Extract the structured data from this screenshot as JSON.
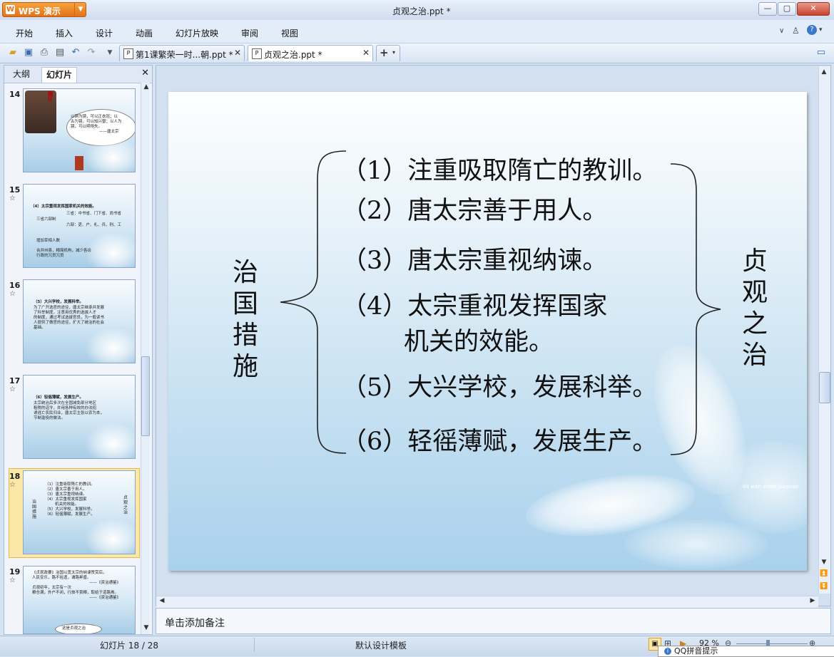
{
  "app": {
    "name": "WPS 演示",
    "document_title": "贞观之治.ppt *",
    "window_buttons": [
      "—",
      "▢",
      "✕"
    ]
  },
  "menu": {
    "items": [
      "开始",
      "插入",
      "设计",
      "动画",
      "幻灯片放映",
      "审阅",
      "视图"
    ]
  },
  "tabs": [
    {
      "label": "第1课繁荣一时...朝.ppt *",
      "active": false
    },
    {
      "label": "贞观之治.ppt *",
      "active": true
    }
  ],
  "tab_add": "+",
  "panel": {
    "tabs": [
      "大纲",
      "幻灯片"
    ],
    "active_tab": "幻灯片",
    "close": "✕"
  },
  "thumbnails": [
    {
      "number": "14",
      "star": "",
      "lines": [
        "魏",
        "征",
        "以铜为镜，可以正衣冠；以",
        "古为镜，可以知兴替；以人为",
        "镜，可以明得失。",
        "——唐太宗"
      ]
    },
    {
      "number": "15",
      "star": "☆",
      "lines": [
        "（4）太宗重视发挥国家机关的效能。",
        "三省六部制",
        "三省：中书省、门下省、尚书省",
        "六部：吏、户、礼、兵、刑、工",
        "增加宰相人数",
        "合并州县，精简机构，减少各级",
        "行政的冗员冗员"
      ]
    },
    {
      "number": "16",
      "star": "☆",
      "lines": [
        "（5）大兴学校，发展科举。",
        "为了广开选官的途径，唐太宗继承并发展",
        "了科举制度，注意用优秀的选拔人才",
        "的制度，通过考试选拔官员，为一般读书",
        "人提供了做官的途径，扩大了统治的社会",
        "基础。"
      ]
    },
    {
      "number": "17",
      "star": "☆",
      "lines": [
        "（6）轻徭薄赋，发展生产。",
        "太宗统治后多次在全国减免部分地区",
        "租税的诏令，并用各种有效的办法招",
        "诱逃亡农民归业，唐太宗主张以农为本，",
        "节制滥役的做法。"
      ]
    },
    {
      "number": "18",
      "star": "☆",
      "selected": true,
      "lines": [
        "治国措施",
        "（1）注重吸取隋亡的教训。",
        "（2）唐太宗善于用人。",
        "（3）唐太宗重视纳谏。",
        "（4）太宗重视发挥国家",
        "机关的效能。",
        "（5）大兴学校，发展科举。",
        "（6）轻徭薄赋，发展生产。",
        "贞观之治"
      ]
    },
    {
      "number": "19",
      "star": "☆",
      "lines": [
        "《贞观政要》治国以宽太宗的纳谏赞赏后，",
        "人民安乐，路不拾遗，谓路昇盛。",
        "——《资治通鉴》",
        "贞观初年，太宗有一次",
        "粮仓满，外户不闭，行旅不赍粮，取给于道路焉。",
        "——《资治通鉴》",
        "这是贞观之治"
      ]
    }
  ],
  "slide": {
    "left_label": "治国措施",
    "right_label": "贞观之治",
    "items": [
      "（1）注重吸取隋亡的教训。",
      "（2）唐太宗善于用人。",
      "（3）唐太宗重视纳谏。",
      "（4）太宗重视发挥国家",
      "机关的效能。",
      "（5）大兴学校，发展科举。",
      "（6）轻徭薄赋，发展生产。"
    ],
    "deco_text": "04 with some purpose"
  },
  "notes_placeholder": "单击添加备注",
  "status": {
    "slide_info": "幻灯片 18 / 28",
    "template": "默认设计模板",
    "zoom": "92 %"
  },
  "popup": "QQ拼音提示",
  "colors": {
    "accent_orange": "#e2721a",
    "selection_yellow": "#fbe8a8"
  }
}
